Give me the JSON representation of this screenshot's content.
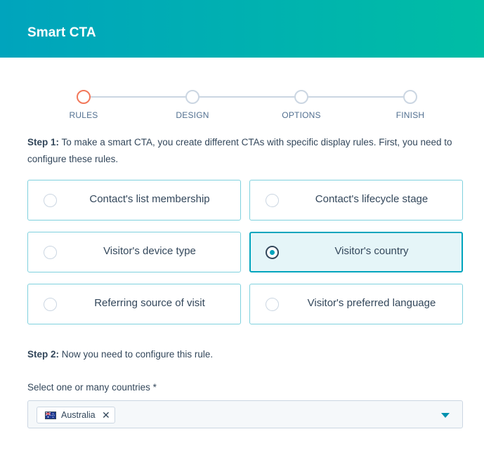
{
  "header": {
    "title": "Smart CTA"
  },
  "steps": [
    {
      "label": "RULES",
      "active": true
    },
    {
      "label": "DESIGN",
      "active": false
    },
    {
      "label": "OPTIONS",
      "active": false
    },
    {
      "label": "FINISH",
      "active": false
    }
  ],
  "step1": {
    "prefix": "Step 1:",
    "text": "To make a smart CTA, you create different CTAs with specific display rules. First, you need to configure these rules."
  },
  "rules": [
    {
      "label": "Contact's list membership",
      "selected": false
    },
    {
      "label": "Contact's lifecycle stage",
      "selected": false
    },
    {
      "label": "Visitor's device type",
      "selected": false
    },
    {
      "label": "Visitor's country",
      "selected": true
    },
    {
      "label": "Referring source of visit",
      "selected": false
    },
    {
      "label": "Visitor's preferred language",
      "selected": false
    }
  ],
  "step2": {
    "prefix": "Step 2:",
    "text": "Now you need to configure this rule."
  },
  "countries": {
    "label": "Select one or many countries *",
    "selected_tags": [
      {
        "text": "Australia",
        "flag": "australia-flag-icon"
      }
    ],
    "remove_glyph": "✕"
  },
  "colors": {
    "header_start": "#00a4bd",
    "header_end": "#00bda5",
    "active_step": "#f2785a",
    "accent": "#00a4bd",
    "selected_bg": "#e5f5f8"
  }
}
